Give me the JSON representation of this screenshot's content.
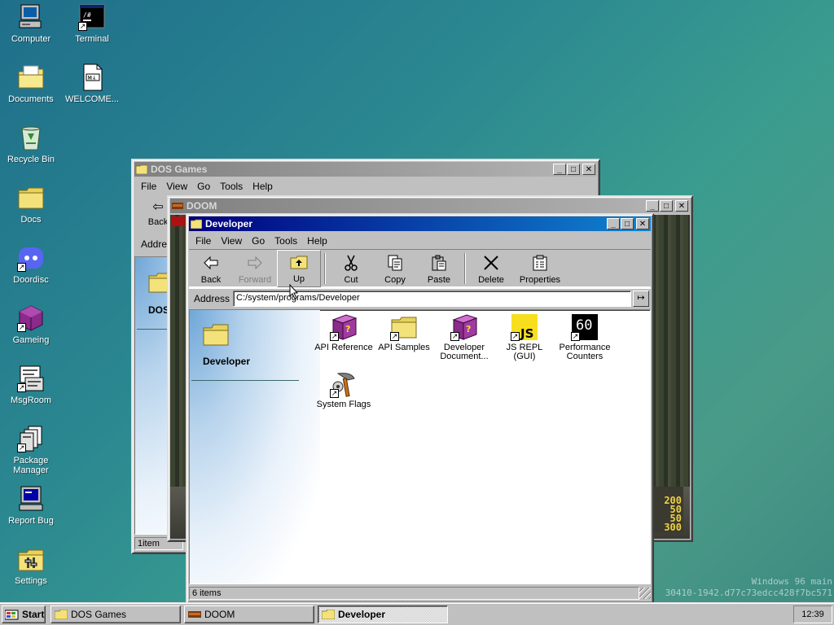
{
  "desktop": {
    "icons": [
      {
        "label": "Computer"
      },
      {
        "label": "Terminal"
      },
      {
        "label": "Documents"
      },
      {
        "label": "WELCOME..."
      },
      {
        "label": "Recycle Bin"
      },
      {
        "label": "Docs"
      },
      {
        "label": "Doordisc"
      },
      {
        "label": "Gameing"
      },
      {
        "label": "MsgRoom"
      },
      {
        "label": "Package Manager"
      },
      {
        "label": "Report Bug"
      },
      {
        "label": "Settings"
      }
    ],
    "watermark_line1": "Windows 96 main",
    "watermark_line2": "30410-1942.d77c73edcc428f7bc571"
  },
  "windows": {
    "dos_games": {
      "title": "DOS Games",
      "menu": [
        "File",
        "View",
        "Go",
        "Tools",
        "Help"
      ],
      "back_label": "Back",
      "address_label": "Addres",
      "side_title": "DOS",
      "status": "1item"
    },
    "doom": {
      "title": "DOOM",
      "hud_values": [
        "200",
        "50",
        "50",
        "300"
      ]
    },
    "developer": {
      "title": "Developer",
      "menu": [
        "File",
        "View",
        "Go",
        "Tools",
        "Help"
      ],
      "toolbar": {
        "back": "Back",
        "forward": "Forward",
        "up": "Up",
        "cut": "Cut",
        "copy": "Copy",
        "paste": "Paste",
        "delete": "Delete",
        "properties": "Properties"
      },
      "address_label": "Address",
      "address_value": "C:/system/programs/Developer",
      "side_title": "Developer",
      "files": [
        {
          "label": "API Reference",
          "icon": "help-book-icon"
        },
        {
          "label": "API Samples",
          "icon": "folder-icon"
        },
        {
          "label": "Developer Document...",
          "icon": "help-book-icon"
        },
        {
          "label": "JS REPL (GUI)",
          "icon": "js-icon"
        },
        {
          "label": "Performance Counters",
          "icon": "fps-counter-icon",
          "badge": "60"
        },
        {
          "label": "System Flags",
          "icon": "system-flags-icon"
        }
      ],
      "status": "6 items"
    }
  },
  "taskbar": {
    "start_label": "Start",
    "tasks": [
      "DOS Games",
      "DOOM",
      "Developer"
    ],
    "clock": "12:39"
  },
  "colors": {
    "title_active": "#000080",
    "title_inactive": "#808080",
    "window_face": "#c0c0c0",
    "folder": "#f3e27a"
  }
}
